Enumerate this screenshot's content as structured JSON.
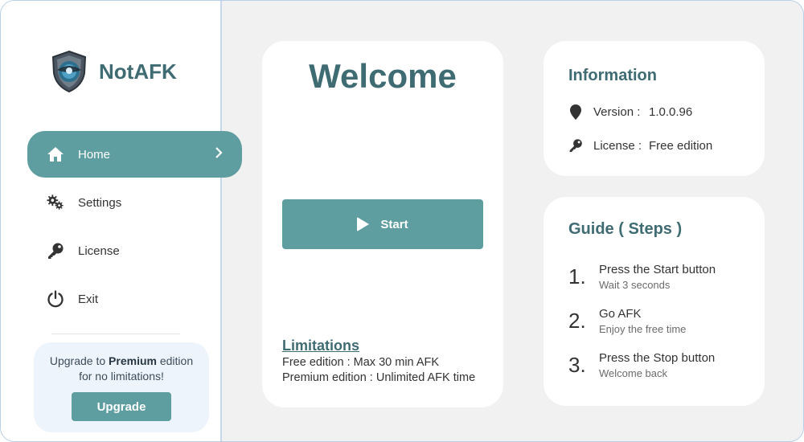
{
  "app": {
    "name": "NotAFK"
  },
  "sidebar": {
    "items": [
      {
        "label": "Home",
        "icon": "home-icon",
        "active": true
      },
      {
        "label": "Settings",
        "icon": "gears-icon",
        "active": false
      },
      {
        "label": "License",
        "icon": "key-icon",
        "active": false
      },
      {
        "label": "Exit",
        "icon": "power-icon",
        "active": false
      }
    ],
    "upgrade": {
      "text_prefix": "Upgrade to ",
      "text_bold": "Premium",
      "text_suffix": " edition",
      "text_line2": "for no limitations!",
      "button_label": "Upgrade"
    }
  },
  "welcome": {
    "title": "Welcome",
    "start_label": "Start",
    "limitations_title": "Limitations",
    "limitations": [
      "Free edition : Max 30 min AFK",
      "Premium edition : Unlimited AFK time"
    ]
  },
  "information": {
    "title": "Information",
    "version_label": "Version :",
    "version_value": "1.0.0.96",
    "license_label": "License :",
    "license_value": "Free edition"
  },
  "guide": {
    "title": "Guide ( Steps )",
    "steps": [
      {
        "num": "1.",
        "title": "Press the Start button",
        "sub": "Wait 3 seconds"
      },
      {
        "num": "2.",
        "title": "Go AFK",
        "sub": "Enjoy the free time"
      },
      {
        "num": "3.",
        "title": "Press the Stop button",
        "sub": "Welcome back"
      }
    ]
  },
  "colors": {
    "accent": "#5f9ea0",
    "title": "#3f6b72",
    "background": "#f1f1f1"
  }
}
